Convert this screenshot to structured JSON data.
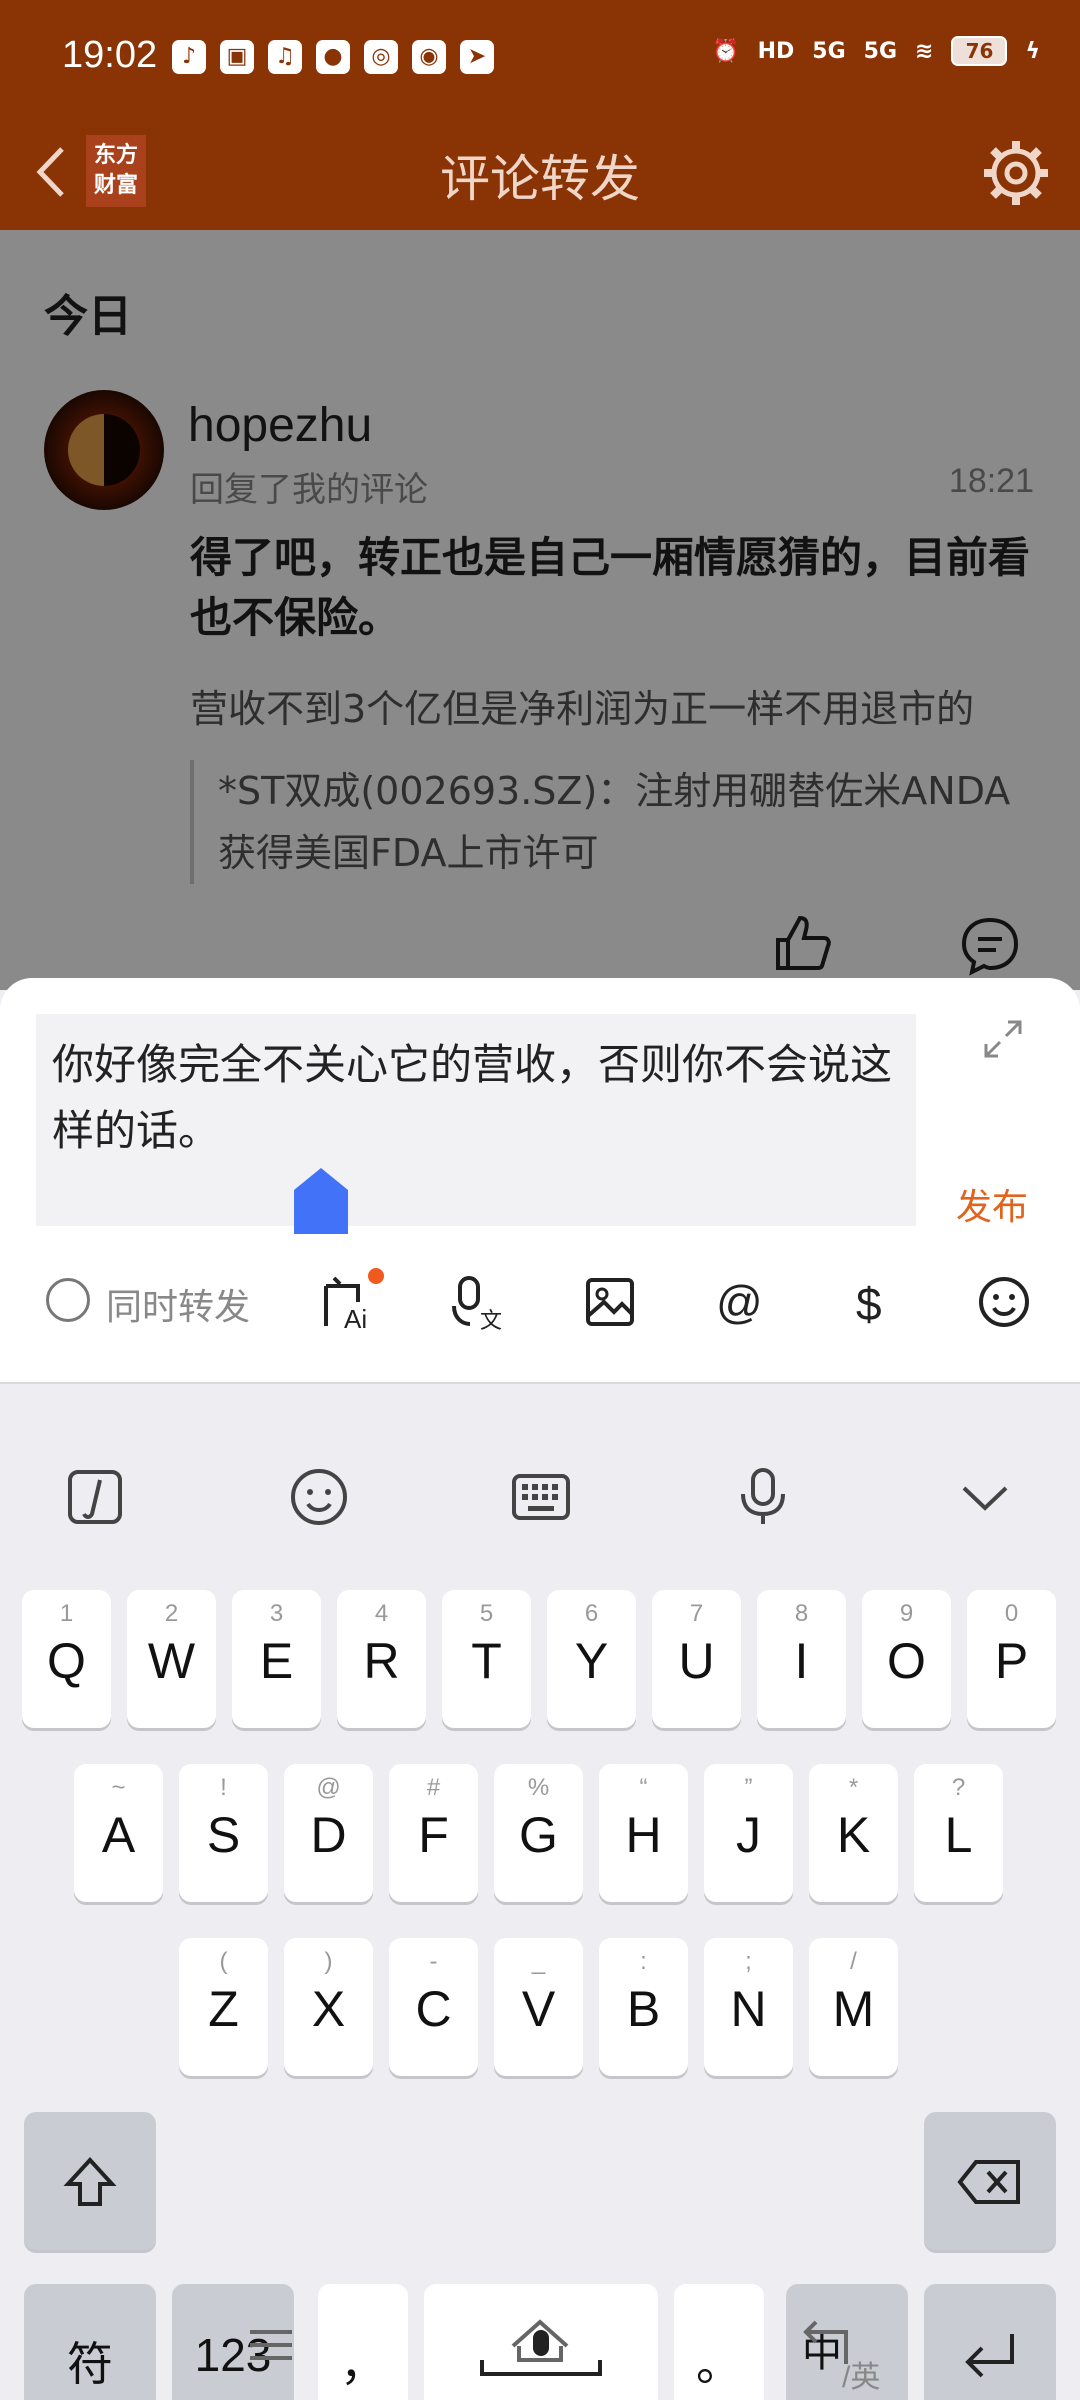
{
  "status": {
    "time": "19:02",
    "battery": "76",
    "net1": "HD",
    "net2": "5G",
    "net3": "5G"
  },
  "header": {
    "title": "评论转发",
    "logo_line1": "东方",
    "logo_line2": "财富"
  },
  "feed": {
    "section": "今日",
    "item": {
      "username": "hopezhu",
      "action": "回复了我的评论",
      "time": "18:21",
      "reply": "得了吧，转正也是自己一厢情愿猜的，目前看也不保险。",
      "original": "营收不到3个亿但是净利润为正一样不用退市的",
      "quote": "*ST双成(002693.SZ)：注射用硼替佐米ANDA获得美国FDA上市许可"
    }
  },
  "composer": {
    "text": "你好像完全不关心它的营收，否则你不会说这样的话。",
    "publish": "发布",
    "forward_label": "同时转发",
    "tools": [
      "ai-ask-icon",
      "voice-to-text-icon",
      "image-icon",
      "at-icon",
      "dollar-icon",
      "emoji-icon"
    ]
  },
  "keyboard": {
    "row1": [
      {
        "k": "Q",
        "s": "1"
      },
      {
        "k": "W",
        "s": "2"
      },
      {
        "k": "E",
        "s": "3"
      },
      {
        "k": "R",
        "s": "4"
      },
      {
        "k": "T",
        "s": "5"
      },
      {
        "k": "Y",
        "s": "6"
      },
      {
        "k": "U",
        "s": "7"
      },
      {
        "k": "I",
        "s": "8"
      },
      {
        "k": "O",
        "s": "9"
      },
      {
        "k": "P",
        "s": "0"
      }
    ],
    "row2": [
      {
        "k": "A",
        "s": "~"
      },
      {
        "k": "S",
        "s": "!"
      },
      {
        "k": "D",
        "s": "@"
      },
      {
        "k": "F",
        "s": "#"
      },
      {
        "k": "G",
        "s": "%"
      },
      {
        "k": "H",
        "s": "“"
      },
      {
        "k": "J",
        "s": "”"
      },
      {
        "k": "K",
        "s": "*"
      },
      {
        "k": "L",
        "s": "?"
      }
    ],
    "row3": [
      {
        "k": "Z",
        "s": "("
      },
      {
        "k": "X",
        "s": ")"
      },
      {
        "k": "C",
        "s": "-"
      },
      {
        "k": "V",
        "s": "_"
      },
      {
        "k": "B",
        "s": ":"
      },
      {
        "k": "N",
        "s": ";"
      },
      {
        "k": "M",
        "s": "/"
      }
    ],
    "symbols": "符",
    "numbers": "123",
    "comma": "，",
    "period": "。",
    "lang_main": "中",
    "lang_sub": "/英"
  }
}
